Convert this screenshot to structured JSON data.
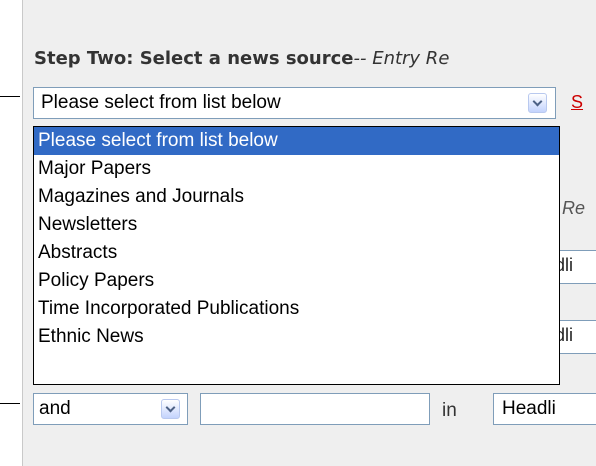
{
  "step_two": {
    "heading": "Step Two: Select a news source",
    "note": "-- Entry Re"
  },
  "source_select": {
    "value": "Please select from list below",
    "side_link": "S",
    "options": [
      "Please select from list below",
      "Major Papers",
      "Magazines and Journals",
      "Newsletters",
      "Abstracts",
      "Policy Papers",
      "Time Incorporated Publications",
      "Ethnic News"
    ]
  },
  "background": {
    "entry_note_fragment": "Re",
    "field_fragment_1": "dli",
    "field_fragment_2": "dli"
  },
  "search_row": {
    "connector": "and",
    "term": "",
    "in_label": "in",
    "field": "Headli"
  },
  "colors": {
    "panel": "#efefef",
    "selection": "#316ac5",
    "link": "#cc0000",
    "input_border": "#7f9db9"
  }
}
